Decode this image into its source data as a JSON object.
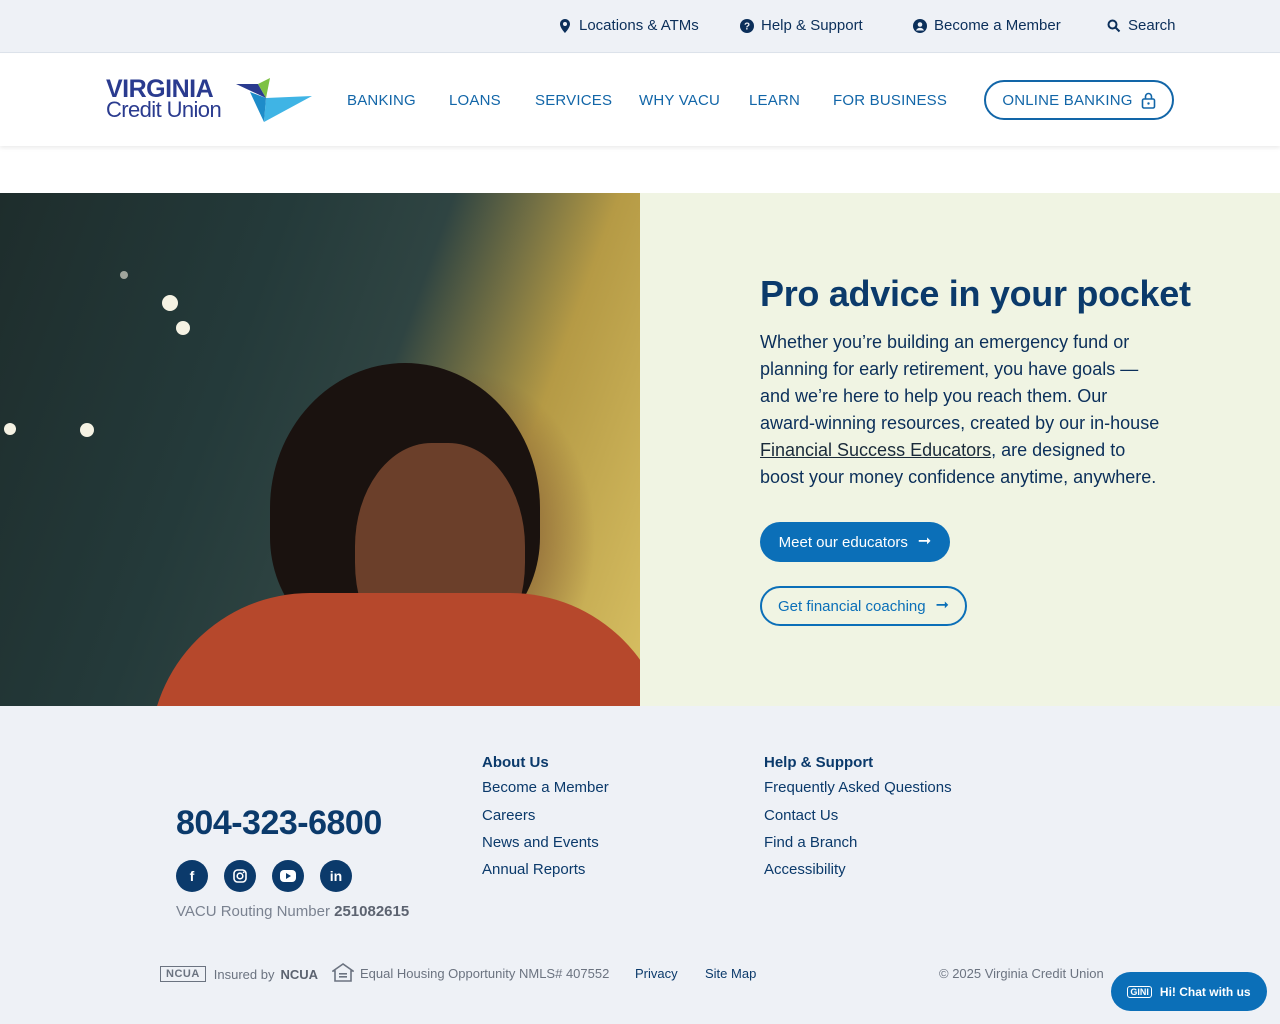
{
  "utility": {
    "locations": "Locations & ATMs",
    "help": "Help & Support",
    "member": "Become a Member",
    "search": "Search"
  },
  "logo": {
    "line1": "VIRGINIA",
    "line2": "Credit Union"
  },
  "nav": {
    "banking": "BANKING",
    "loans": "LOANS",
    "services": "SERVICES",
    "why": "WHY VACU",
    "learn": "LEARN",
    "business": "FOR BUSINESS",
    "online_banking": "ONLINE BANKING"
  },
  "hero": {
    "title": "Pro advice in your pocket",
    "body_before": "Whether you’re building an emergency fund or planning for early retirement, you have goals — and we’re here to help you reach them. Our award-winning resources, created by our in-house ",
    "body_link": "Financial Success Educators",
    "body_after": ", are designed to boost your money confidence anytime, anywhere.",
    "primary_button": "Meet our educators",
    "secondary_button": "Get financial coaching"
  },
  "footer": {
    "phone": "804-323-6800",
    "routing_label": "VACU Routing Number",
    "routing_number": "251082615",
    "about_title": "About Us",
    "about_links": [
      "Become a Member",
      "Careers",
      "News and Events",
      "Annual Reports"
    ],
    "help_title": "Help & Support",
    "help_links": [
      "Frequently Asked Questions",
      "Contact Us",
      "Find a Branch",
      "Accessibility"
    ],
    "ncua_badge": "NCUA",
    "insured_label": "Insured by",
    "insured_org": "NCUA",
    "equal_housing": "Equal Housing Opportunity NMLS# 407552",
    "privacy": "Privacy",
    "sitemap": "Site Map",
    "copyright": "© 2025 Virginia Credit Union"
  },
  "chat": {
    "badge": "GINI",
    "label": "Hi! Chat with us"
  }
}
